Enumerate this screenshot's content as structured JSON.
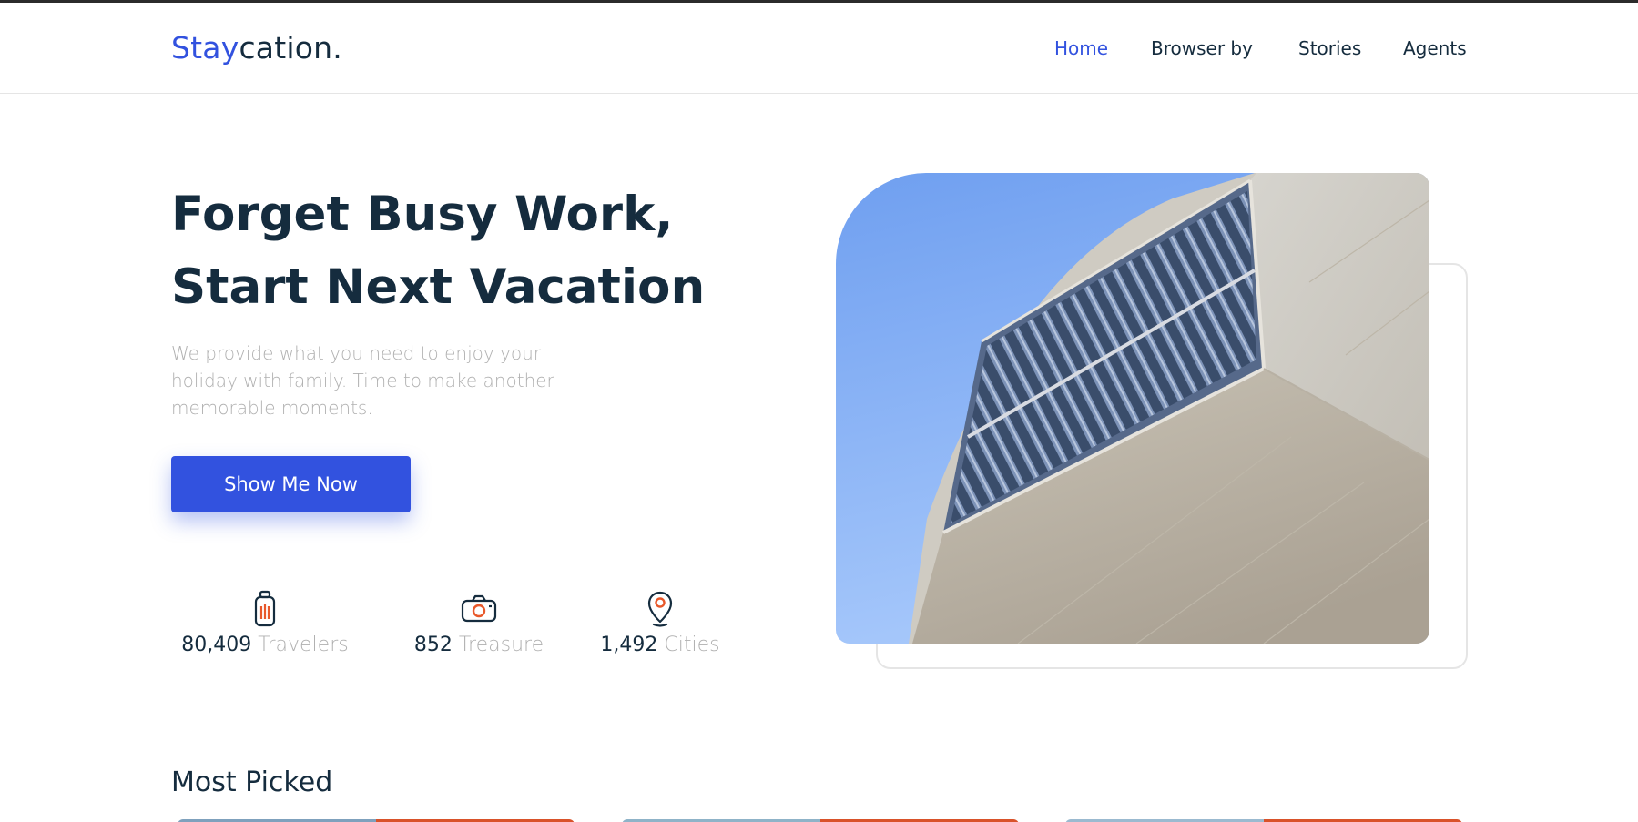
{
  "brand": {
    "accent": "Stay",
    "rest": "cation."
  },
  "nav": [
    {
      "label": "Home",
      "active": true
    },
    {
      "label": "Browser by",
      "active": false
    },
    {
      "label": "Stories",
      "active": false
    },
    {
      "label": "Agents",
      "active": false
    }
  ],
  "hero": {
    "title_line1": "Forget Busy Work,",
    "title_line2": "Start Next Vacation",
    "description": "We provide what you need to enjoy your holiday with family. Time to make another memorable moments.",
    "cta_label": "Show Me Now"
  },
  "stats": [
    {
      "value": "80,409",
      "label": "Travelers",
      "icon": "suitcase-icon"
    },
    {
      "value": "852",
      "label": "Treasure",
      "icon": "camera-icon"
    },
    {
      "value": "1,492",
      "label": "Cities",
      "icon": "map-pin-icon"
    }
  ],
  "sections": {
    "most_picked": "Most Picked"
  },
  "colors": {
    "primary": "#3252df",
    "text": "#152c3e",
    "muted": "#b0b0b0",
    "accent": "#ff498b",
    "icon_orange": "#e8582a"
  }
}
